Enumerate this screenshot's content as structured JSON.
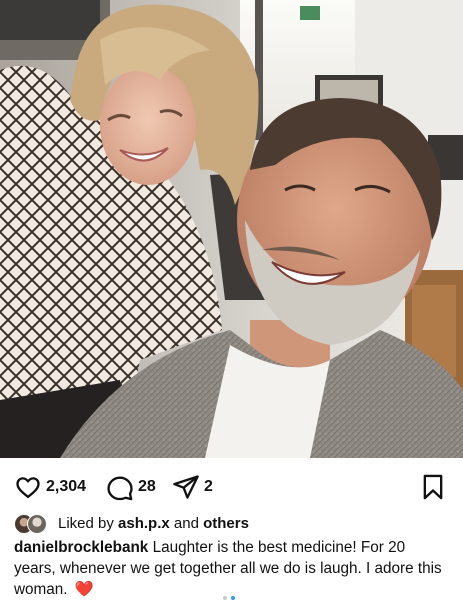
{
  "post": {
    "likes": "2,304",
    "comments": "28",
    "shares": "2",
    "liked_by_prefix": "Liked by",
    "liked_by_user": "ash.p.x",
    "liked_by_and": "and",
    "liked_by_others": "others",
    "username": "danielbrocklebank",
    "caption": "Laughter is the best medicine! For 20 years, whenever we get together all we do is laugh. I adore this woman.",
    "caption_emoji": "❤️"
  },
  "icons": {
    "like": "heart-outline-icon",
    "comment": "comment-bubble-icon",
    "share": "paper-plane-icon",
    "save": "bookmark-icon"
  }
}
